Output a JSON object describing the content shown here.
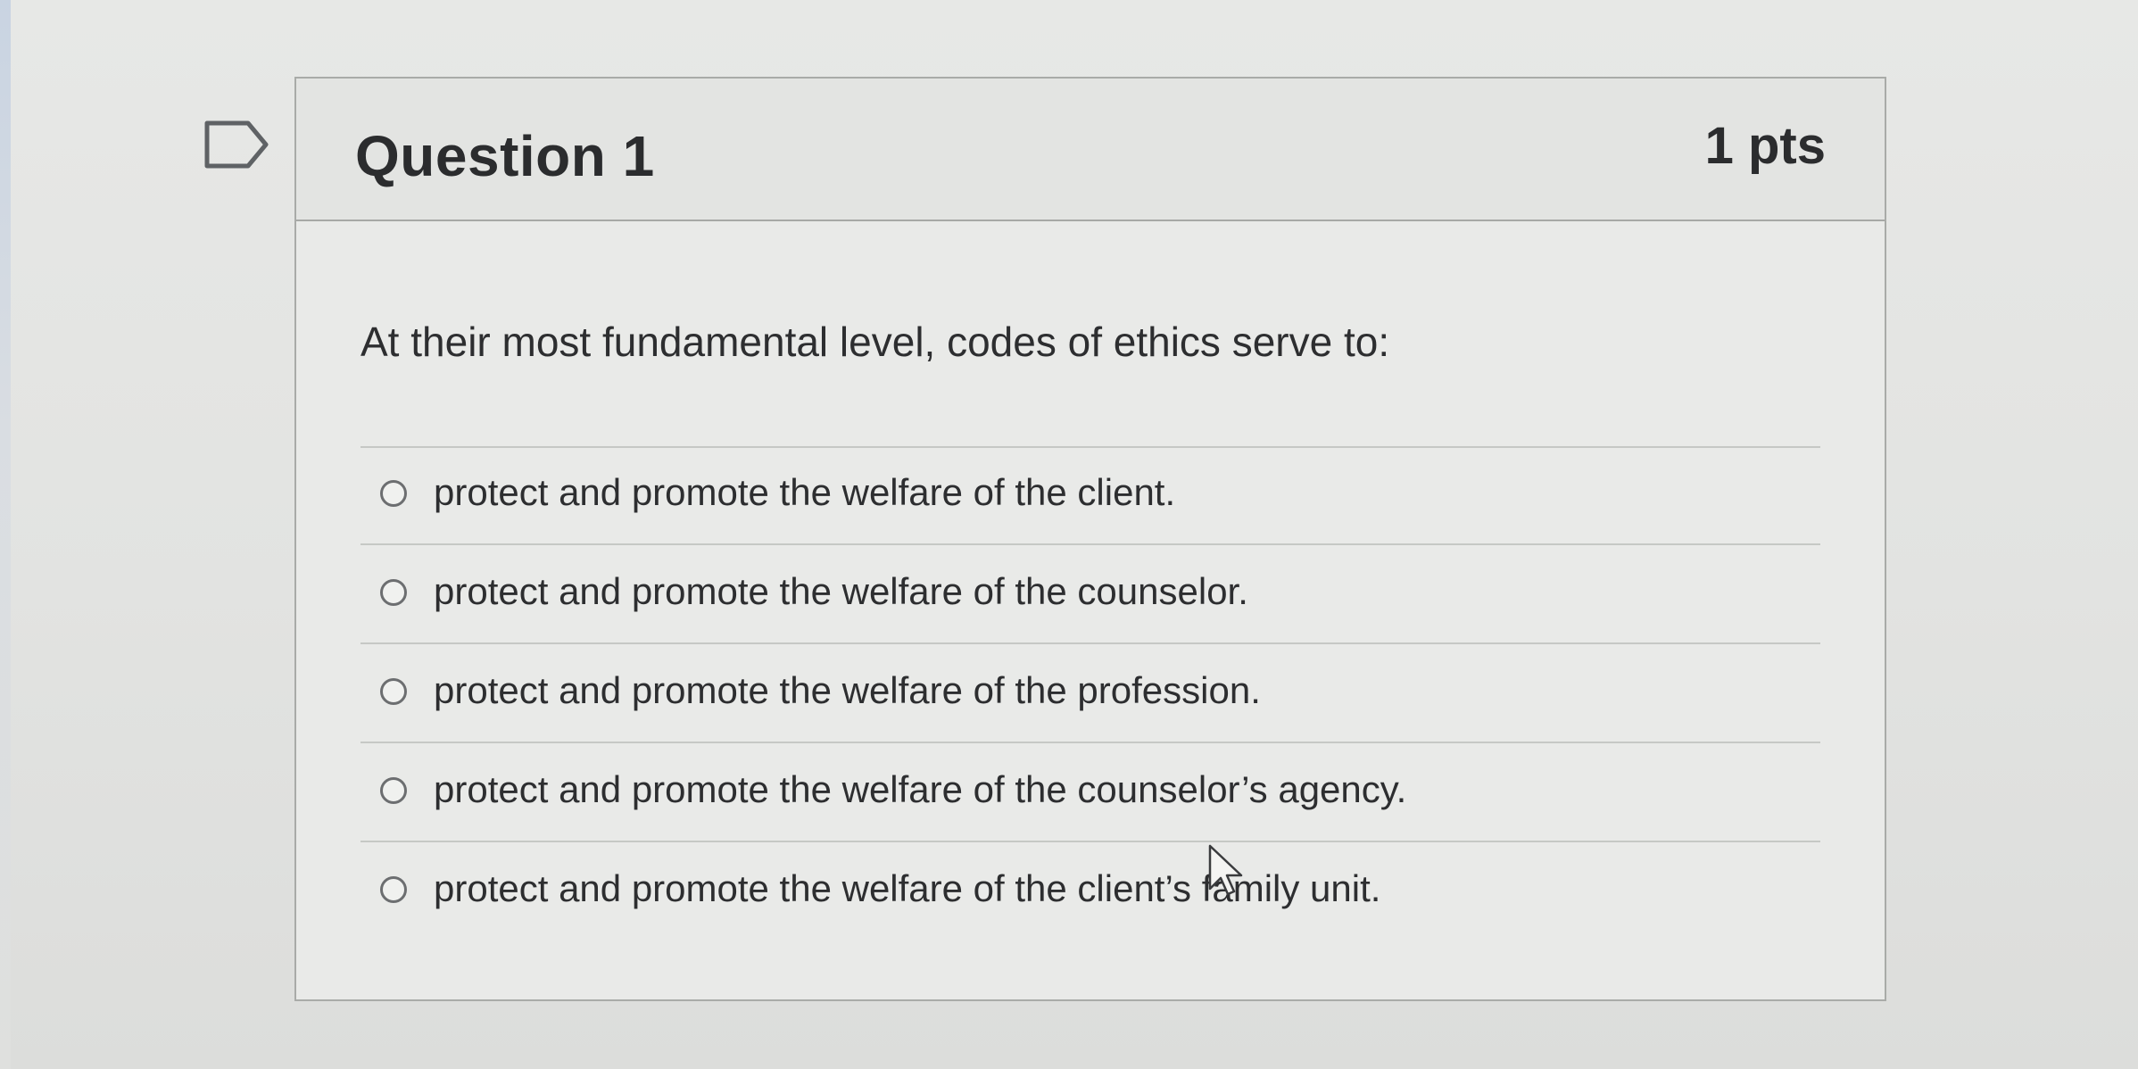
{
  "question": {
    "title": "Question 1",
    "points": "1 pts",
    "prompt": "At their most fundamental level, codes of ethics serve to:",
    "answers": [
      {
        "label": "protect and promote the welfare of the client."
      },
      {
        "label": "protect and promote the welfare of the counselor."
      },
      {
        "label": "protect and promote the welfare of the profession."
      },
      {
        "label": "protect and promote the welfare of the counselor’s agency."
      },
      {
        "label": "protect and promote the welfare of the client’s family unit."
      }
    ]
  },
  "icons": {
    "flag": "flag-outline-icon",
    "cursor": "mouse-pointer-icon"
  },
  "colors": {
    "text": "#2d2e30",
    "border": "#a9aba8",
    "header_bg": "#e3e4e2",
    "card_bg": "#e9eae8"
  }
}
